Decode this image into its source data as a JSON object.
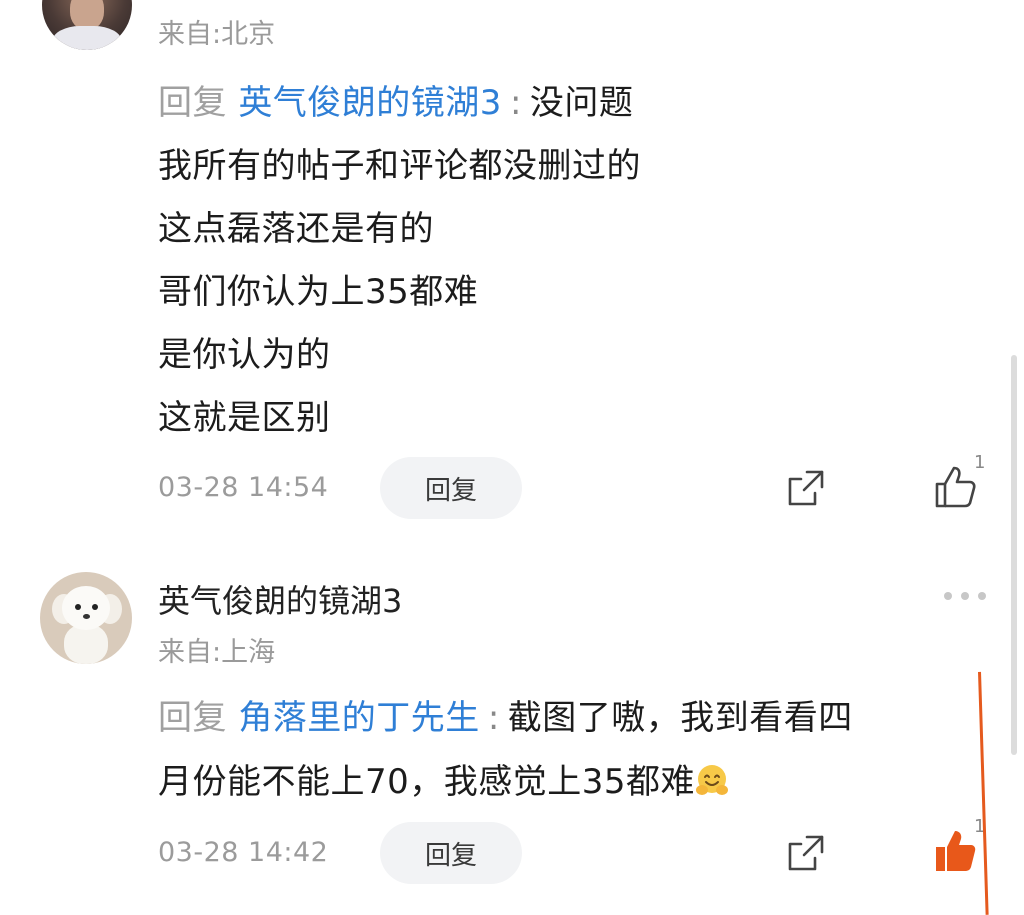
{
  "comment1": {
    "location": "来自:北京",
    "reply_prefix": "回复",
    "mention": "英气俊朗的镜湖3",
    "colon": ":",
    "lines": [
      "没问题",
      "我所有的帖子和评论都没删过的",
      "这点磊落还是有的",
      "哥们你认为上35都难",
      "是你认为的",
      "这就是区别"
    ],
    "timestamp": "03-28 14:54",
    "reply_button": "回复",
    "like_count": "1",
    "liked": false
  },
  "comment2": {
    "username": "英气俊朗的镜湖3",
    "location": "来自:上海",
    "reply_prefix": "回复",
    "mention": "角落里的丁先生",
    "colon": ":",
    "line1_text": "截图了嗷，我到看看四",
    "line2_text": "月份能不能上70，我感觉上35都难",
    "emoji_icon": "hugging-face-emoji",
    "timestamp": "03-28 14:42",
    "reply_button": "回复",
    "like_count": "1",
    "liked": true
  },
  "colors": {
    "mention": "#2f7fd6",
    "liked": "#e8581a",
    "annotation": "#e55a1e"
  }
}
